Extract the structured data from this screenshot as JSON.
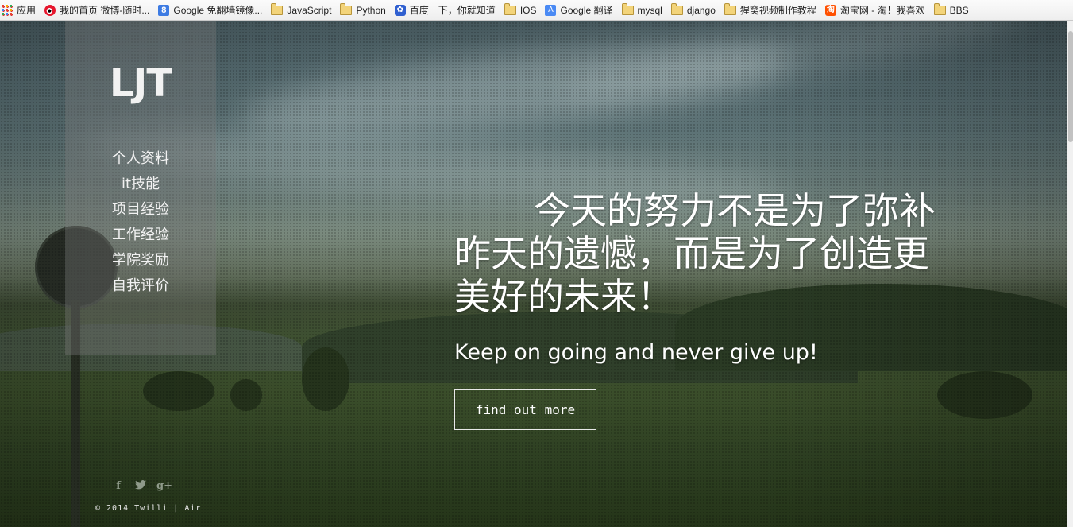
{
  "bookmarks": [
    {
      "label": "应用",
      "icon": "apps-icon"
    },
    {
      "label": "我的首页 微博-随时...",
      "icon": "weibo-icon"
    },
    {
      "label": "Google 免翻墙镜像...",
      "icon": "google-icon"
    },
    {
      "label": "JavaScript",
      "icon": "folder-icon"
    },
    {
      "label": "Python",
      "icon": "folder-icon"
    },
    {
      "label": "百度一下，你就知道",
      "icon": "baidu-icon"
    },
    {
      "label": "IOS",
      "icon": "folder-icon"
    },
    {
      "label": "Google 翻译",
      "icon": "google-translate-icon"
    },
    {
      "label": "mysql",
      "icon": "folder-icon"
    },
    {
      "label": "django",
      "icon": "folder-icon"
    },
    {
      "label": "猩窝视频制作教程",
      "icon": "folder-icon"
    },
    {
      "label": "淘宝网 - 淘！我喜欢",
      "icon": "taobao-icon"
    },
    {
      "label": "BBS",
      "icon": "folder-icon"
    }
  ],
  "sidebar": {
    "logo": "LJT",
    "nav": [
      "个人资料",
      "it技能",
      "项目经验",
      "工作经验",
      "学院奖励",
      "自我评价"
    ],
    "social": [
      {
        "glyph": "f",
        "icon": "facebook-icon"
      },
      {
        "glyph": "🐦",
        "icon": "twitter-icon"
      },
      {
        "glyph": "g+",
        "icon": "google-plus-icon"
      }
    ],
    "copyright": "© 2014 Twilli | Air"
  },
  "hero": {
    "headline": "今天的努力不是为了弥补昨天的遗憾，而是为了创造更美好的未来！",
    "subline": "Keep on going and never give up!",
    "cta_label": "find out more"
  },
  "colors": {
    "sidebar_bg": "rgba(120,120,120,.38)",
    "text": "#ffffff"
  }
}
